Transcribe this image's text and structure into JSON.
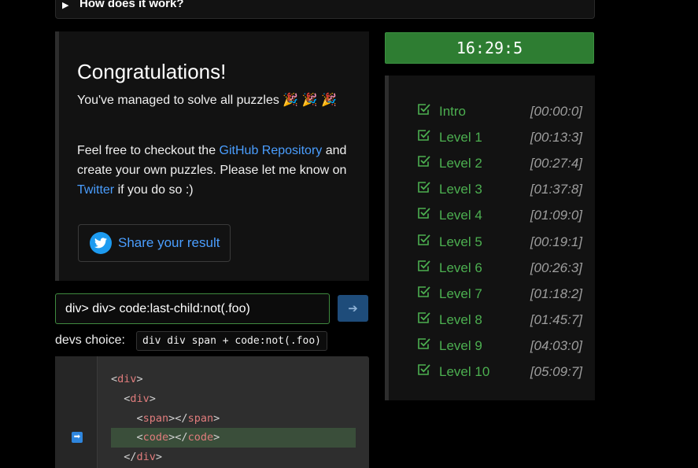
{
  "details": {
    "summary": "How does it work?"
  },
  "congrats": {
    "title": "Congratulations!",
    "p1_text": "You've managed to solve all puzzles 🎉 🎉 🎉",
    "p2_before": "Feel free to checkout the ",
    "github_link": "GitHub Repository",
    "p2_middle": " and create your own puzzles. Please let me know on ",
    "twitter_link": "Twitter",
    "p2_after": " if you do so :)",
    "share_label": "Share your result"
  },
  "selector": {
    "value": "div> div> code:last-child:not(.foo)",
    "submit_icon": "arrow-right-icon"
  },
  "devs_choice": {
    "label": "devs choice:",
    "code": "div div span + code:not(.foo)"
  },
  "code_panel": {
    "lines": [
      {
        "indent": "",
        "parts": [
          "<",
          "div",
          ">"
        ]
      },
      {
        "indent": "  ",
        "parts": [
          "<",
          "div",
          ">"
        ]
      },
      {
        "indent": "    ",
        "parts": [
          "<",
          "span",
          "></",
          "span",
          ">"
        ]
      },
      {
        "indent": "    ",
        "parts": [
          "<",
          "code",
          "></",
          "code",
          ">"
        ]
      },
      {
        "indent": "  ",
        "parts": [
          "</",
          "div",
          ">"
        ]
      }
    ],
    "highlighted_line": 3
  },
  "timer": {
    "value": "16:29:5"
  },
  "levels": [
    {
      "name": "Intro",
      "time": "[00:00:0]"
    },
    {
      "name": "Level 1",
      "time": "[00:13:3]"
    },
    {
      "name": "Level 2",
      "time": "[00:27:4]"
    },
    {
      "name": "Level 3",
      "time": "[01:37:8]"
    },
    {
      "name": "Level 4",
      "time": "[01:09:0]"
    },
    {
      "name": "Level 5",
      "time": "[00:19:1]"
    },
    {
      "name": "Level 6",
      "time": "[00:26:3]"
    },
    {
      "name": "Level 7",
      "time": "[01:18:2]"
    },
    {
      "name": "Level 8",
      "time": "[01:45:7]"
    },
    {
      "name": "Level 9",
      "time": "[04:03:0]"
    },
    {
      "name": "Level 10",
      "time": "[05:09:7]"
    }
  ],
  "colors": {
    "accent_green": "#4caf50",
    "link_blue": "#4a9eff",
    "timer_bg": "#2e7d32"
  }
}
